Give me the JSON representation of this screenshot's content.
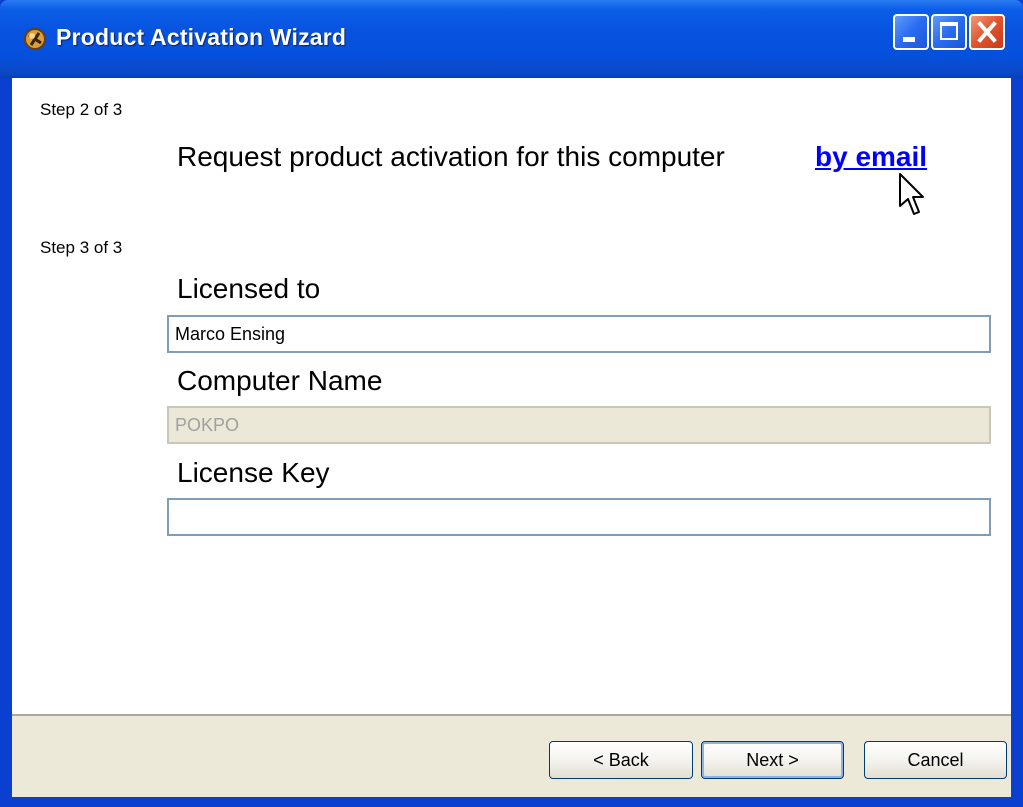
{
  "window": {
    "title": "Product Activation Wizard"
  },
  "step2": {
    "label": "Step 2 of 3",
    "request_text": "Request product activation for this computer",
    "email_link": "by email"
  },
  "step3": {
    "label": "Step 3 of 3",
    "licensed_to_label": "Licensed to",
    "licensed_to_value": "Marco Ensing",
    "computer_name_label": "Computer Name",
    "computer_name_value": "POKPO",
    "license_key_label": "License Key",
    "license_key_value": ""
  },
  "buttons": {
    "back": "< Back",
    "next": "Next >",
    "cancel": "Cancel"
  },
  "colors": {
    "titlebar": "#0753e0",
    "link": "#0000ff",
    "footer": "#ece9d8"
  }
}
